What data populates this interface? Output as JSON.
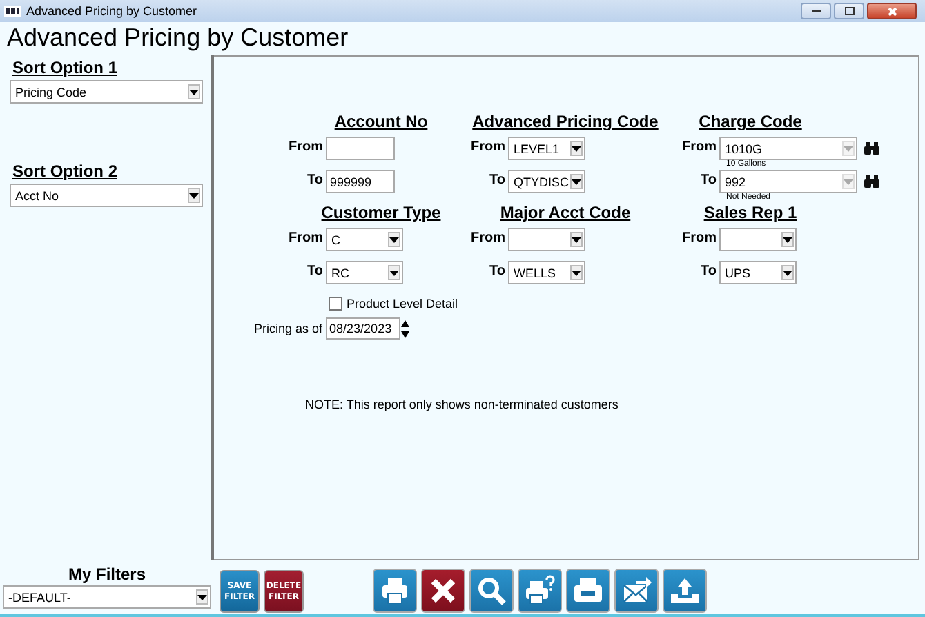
{
  "window": {
    "title": "Advanced Pricing by Customer"
  },
  "heading": "Advanced Pricing by Customer",
  "sort_options": [
    {
      "label": "Sort Option 1",
      "value": "Pricing Code"
    },
    {
      "label": "Sort Option 2",
      "value": "Acct No"
    }
  ],
  "filters": [
    {
      "title": "Account No",
      "kind": "text",
      "from": {
        "label": "From"
      },
      "to": {
        "label": "To",
        "value": "999999"
      }
    },
    {
      "title": "Advanced Pricing Code",
      "kind": "dropdown",
      "from": {
        "label": "From",
        "value": "LEVEL1"
      },
      "to": {
        "label": "To",
        "value": "QTYDISC"
      }
    },
    {
      "title": "Charge Code",
      "kind": "lookup",
      "from": {
        "label": "From",
        "value": "1010G",
        "caption": "10 Gallons"
      },
      "to": {
        "label": "To",
        "value": "992",
        "caption": "Not Needed"
      }
    },
    {
      "title": "Customer Type",
      "kind": "dropdown",
      "from": {
        "label": "From",
        "value": "C"
      },
      "to": {
        "label": "To",
        "value": "RC"
      }
    },
    {
      "title": "Major Acct Code",
      "kind": "dropdown",
      "from": {
        "label": "From"
      },
      "to": {
        "label": "To",
        "value": "WELLS"
      }
    },
    {
      "title": "Sales Rep 1",
      "kind": "dropdown",
      "from": {
        "label": "From"
      },
      "to": {
        "label": "To",
        "value": "UPS"
      }
    }
  ],
  "product_level_detail": {
    "label": "Product Level Detail",
    "checked": false
  },
  "pricing_as_of": {
    "label": "Pricing as of",
    "value": "08/23/2023"
  },
  "note": "NOTE: This report only shows non-terminated customers",
  "my_filters": {
    "title": "My Filters",
    "value": "-DEFAULT-"
  },
  "filter_buttons": [
    {
      "kind": "save",
      "label": "SAVE FILTER"
    },
    {
      "kind": "delete",
      "label": "DELETE FILTER"
    }
  ],
  "toolbar": [
    {
      "kind": "print"
    },
    {
      "kind": "cancel"
    },
    {
      "kind": "search"
    },
    {
      "kind": "print-help"
    },
    {
      "kind": "fax"
    },
    {
      "kind": "email"
    },
    {
      "kind": "export"
    }
  ]
}
